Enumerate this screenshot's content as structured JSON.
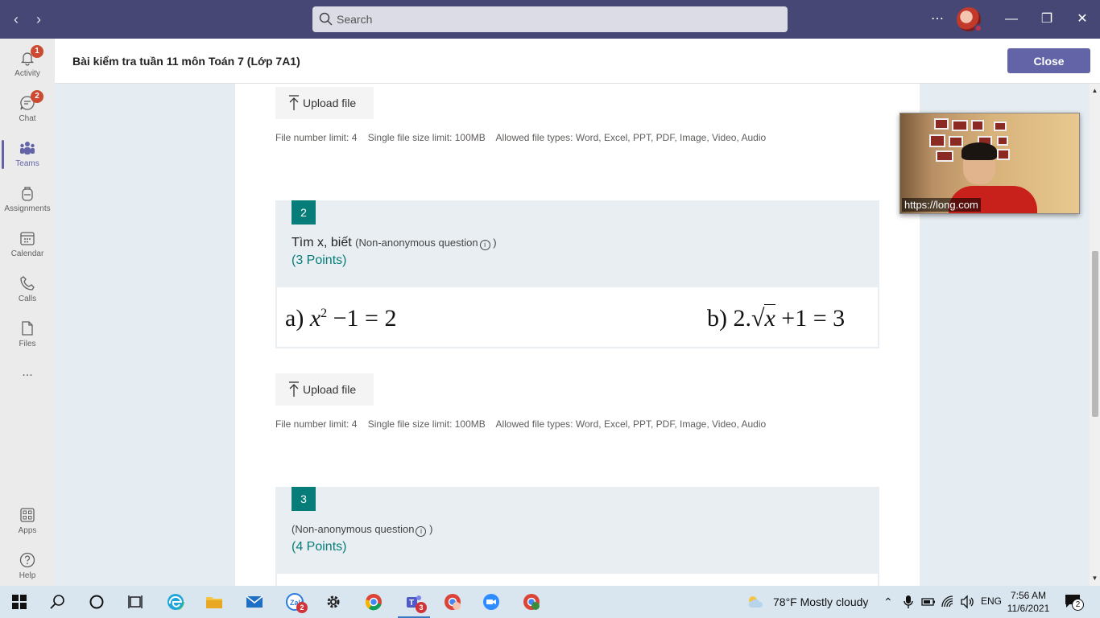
{
  "titlebar": {
    "search_placeholder": "Search"
  },
  "rail": {
    "items": [
      {
        "label": "Activity",
        "badge": "1"
      },
      {
        "label": "Chat",
        "badge": "2"
      },
      {
        "label": "Teams"
      },
      {
        "label": "Assignments"
      },
      {
        "label": "Calendar"
      },
      {
        "label": "Calls"
      },
      {
        "label": "Files"
      },
      {
        "label": "Apps"
      },
      {
        "label": "Help"
      }
    ],
    "more": "..."
  },
  "header": {
    "title": "Bài kiểm tra tuần 11 môn Toán 7 (Lớp 7A1)",
    "close_label": "Close"
  },
  "upload": {
    "label": "Upload file",
    "file_number_limit": "File number limit: 4",
    "single_size_limit": "Single file size limit: 100MB",
    "allowed_types": "Allowed file types: Word, Excel, PPT, PDF, Image, Video, Audio"
  },
  "questions": [
    {
      "number": "2",
      "title": "Tìm x, biết",
      "non_anon": "(Non-anonymous question",
      "non_anon_close": ")",
      "points": "(3 Points)",
      "math_a_prefix": "a)",
      "math_a_var": "x",
      "math_a_exp": "2",
      "math_a_rest": "−1 = 2",
      "math_b_prefix": "b)  2.",
      "math_b_var": "x",
      "math_b_rest": "+1 = 3"
    },
    {
      "number": "3",
      "title": "",
      "non_anon": "(Non-anonymous question",
      "non_anon_close": ")",
      "points": "(4 Points)"
    }
  ],
  "video": {
    "label": "https://long.com"
  },
  "taskbar": {
    "chat_badge": "2",
    "teams_badge": "3",
    "weather": "78°F  Mostly cloudy",
    "language": "ENG",
    "time": "7:56 AM",
    "date": "11/6/2021",
    "notifications": "2"
  }
}
